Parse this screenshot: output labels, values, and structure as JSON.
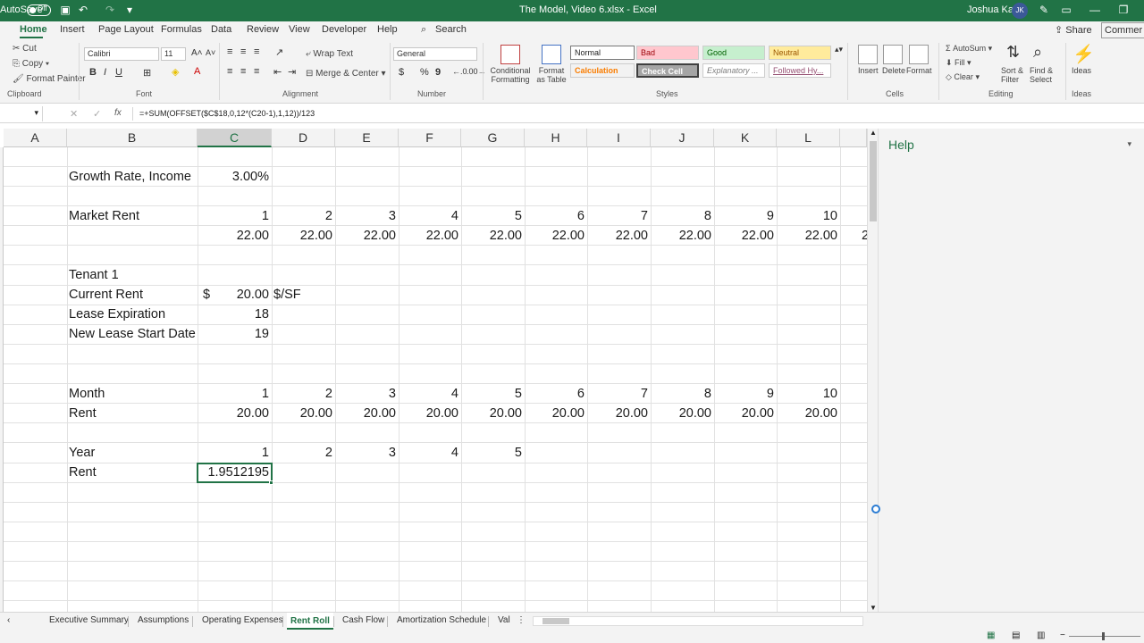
{
  "titlebar": {
    "autosave_label": "AutoSave",
    "autosave_state": "Off",
    "file_title": "The Model, Video 6.xlsx  -  Excel",
    "user_name": "Joshua Kahr",
    "user_initials": "JK"
  },
  "ribbon_tabs": [
    "Home",
    "Insert",
    "Page Layout",
    "Formulas",
    "Data",
    "Review",
    "View",
    "Developer",
    "Help"
  ],
  "search_label": "Search",
  "share_label": "Share",
  "comments_label": "Commer",
  "clipboard": {
    "cut": "Cut",
    "copy": "Copy",
    "format_painter": "Format Painter",
    "title": "Clipboard"
  },
  "font": {
    "name": "Calibri",
    "size": "11",
    "title": "Font",
    "bold": "B",
    "italic": "I",
    "underline": "U"
  },
  "alignment": {
    "wrap_text": "Wrap Text",
    "merge_center": "Merge & Center",
    "title": "Alignment"
  },
  "number": {
    "format": "General",
    "currency": "$",
    "percent": "%",
    "comma": "9",
    "title": "Number"
  },
  "styles": {
    "conditional_formatting": "Conditional Formatting",
    "format_as_table": "Format as Table",
    "title": "Styles",
    "boxes": [
      "Normal",
      "Bad",
      "Good",
      "Neutral",
      "Calculation",
      "Check Cell",
      "Explanatory ...",
      "Followed Hy..."
    ]
  },
  "cells_group": {
    "insert": "Insert",
    "delete": "Delete",
    "format": "Format",
    "title": "Cells"
  },
  "editing": {
    "autosum": "AutoSum",
    "fill": "Fill",
    "clear": "Clear",
    "sort_filter": "Sort & Filter",
    "find_select": "Find & Select",
    "title": "Editing"
  },
  "ideas": {
    "label": "Ideas",
    "title": "Ideas"
  },
  "formula_bar": {
    "fx": "fx",
    "formula": "=+SUM(OFFSET($C$18,0,12*(C20-1),1,12))/123"
  },
  "columns": [
    "A",
    "B",
    "C",
    "D",
    "E",
    "F",
    "G",
    "H",
    "I",
    "J",
    "K",
    "L"
  ],
  "sheet": {
    "growth_label": "Growth Rate, Income",
    "growth_value": "3.00%",
    "market_rent_label": "Market Rent",
    "market_periods": [
      "1",
      "2",
      "3",
      "4",
      "5",
      "6",
      "7",
      "8",
      "9",
      "10"
    ],
    "market_values": [
      "22.00",
      "22.00",
      "22.00",
      "22.00",
      "22.00",
      "22.00",
      "22.00",
      "22.00",
      "22.00",
      "22.00"
    ],
    "market_overflow": "2",
    "tenant_label": "Tenant 1",
    "current_rent_label": "Current Rent",
    "current_rent_currency": "$",
    "current_rent_value": "20.00",
    "current_rent_unit": "$/SF",
    "lease_exp_label": "Lease Expiration",
    "lease_exp_value": "18",
    "new_lease_label": "New Lease Start Date",
    "new_lease_value": "19",
    "month_label": "Month",
    "month_values": [
      "1",
      "2",
      "3",
      "4",
      "5",
      "6",
      "7",
      "8",
      "9",
      "10"
    ],
    "rent_label": "Rent",
    "rent_values": [
      "20.00",
      "20.00",
      "20.00",
      "20.00",
      "20.00",
      "20.00",
      "20.00",
      "20.00",
      "20.00",
      "20.00"
    ],
    "year_label": "Year",
    "year_values": [
      "1",
      "2",
      "3",
      "4",
      "5"
    ],
    "annual_rent_label": "Rent",
    "annual_rent_value": "1.9512195"
  },
  "help_pane": {
    "title": "Help"
  },
  "sheet_tabs": [
    "Executive Summary",
    "Assumptions",
    "Operating Expenses",
    "Rent Roll",
    "Cash Flow",
    "Amortization Schedule",
    "Valu"
  ],
  "active_sheet": "Rent Roll"
}
